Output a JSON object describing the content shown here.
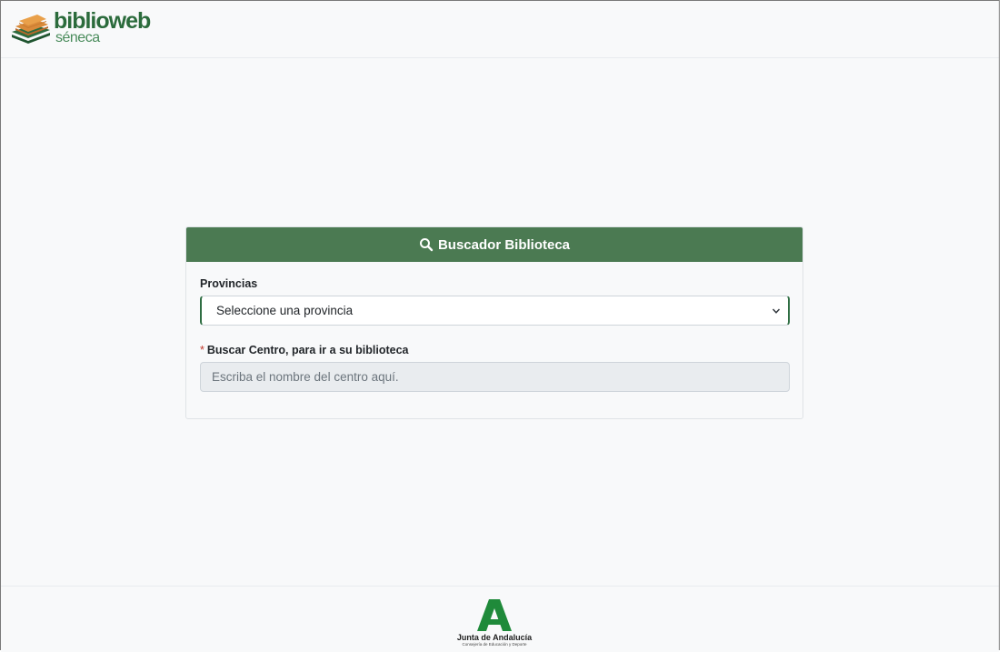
{
  "header": {
    "logo_main": "biblioweb",
    "logo_sub": "séneca"
  },
  "search_card": {
    "title": "Buscador Biblioteca",
    "provinces_label": "Provincias",
    "provinces_selected": "Seleccione una provincia",
    "center_label": "Buscar Centro, para ir a su biblioteca",
    "required_marker": "*",
    "center_placeholder": "Escriba el nombre del centro aquí."
  },
  "footer": {
    "org_name": "Junta de Andalucía",
    "org_sub": "Consejería de Educación y Deporte"
  },
  "colors": {
    "header_green": "#4b7a52",
    "brand_green": "#2b6b3c",
    "required_red": "#c0392b"
  },
  "icons": {
    "search": "search-icon",
    "dropdown": "chevron-down-icon",
    "logo_books": "books-logo-icon",
    "junta": "junta-andalucia-logo"
  }
}
